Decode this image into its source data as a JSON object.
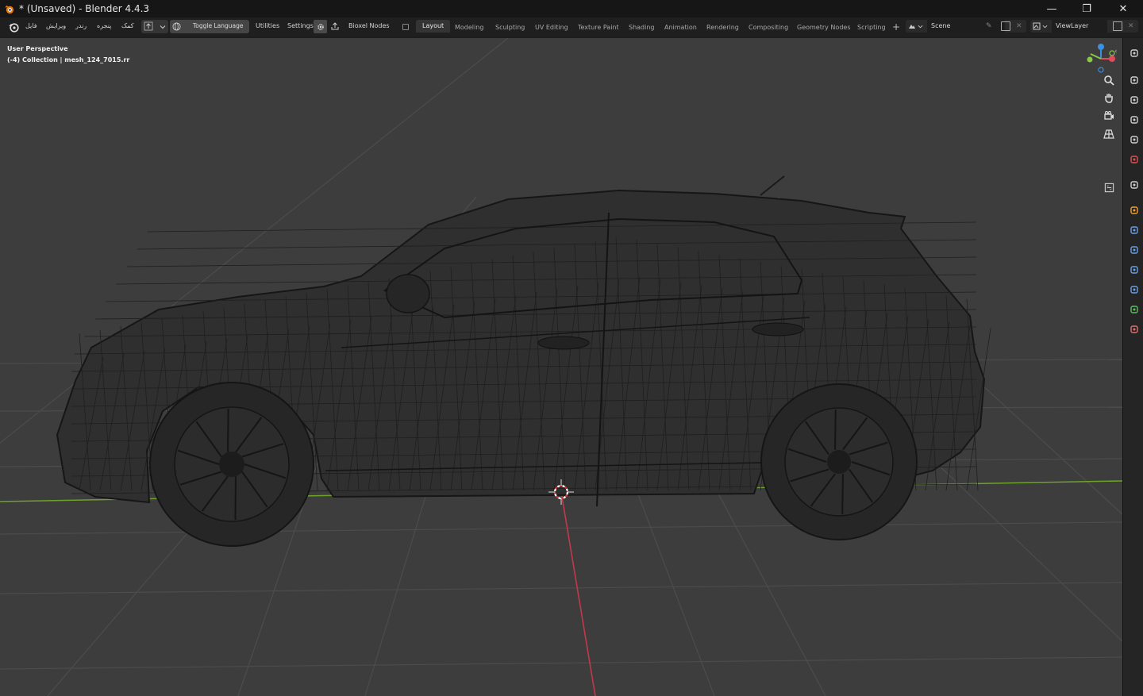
{
  "window": {
    "title": "* (Unsaved) - Blender 4.4.3",
    "minimize": "—",
    "maximize": "❐",
    "close": "✕"
  },
  "menu": {
    "items": [
      "فایل",
      "ویرایش",
      "رندر",
      "پنجره",
      "کمک"
    ],
    "toggle_language": "Toggle Language",
    "utilities": "Utilities",
    "settings": "Settings",
    "bioxel": "Bioxel Nodes"
  },
  "workspaces": [
    "Layout",
    "Modeling",
    "Sculpting",
    "UV Editing",
    "Texture Paint",
    "Shading",
    "Animation",
    "Rendering",
    "Compositing",
    "Geometry Nodes",
    "Scripting"
  ],
  "workspace_add": "+",
  "scene": {
    "name": "Scene"
  },
  "view_layer": {
    "name": "ViewLayer"
  },
  "viewport": {
    "view_name": "User Perspective",
    "collection_info": "(-4) Collection | mesh_124_7015.rr",
    "shading": "wireframe"
  },
  "gizmo": {
    "x_color": "#e34a5b",
    "y_color": "#8bc84a",
    "z_color": "#3d8fe0"
  },
  "colors": {
    "viewport_bg": "#3d3d3d",
    "grid": "#4c4c4c",
    "x_axis": "#c2394b",
    "y_axis": "#6ea12a",
    "wire": "#1a1a1a",
    "active_tab": "#343434"
  },
  "nav_icons": [
    "zoom-icon",
    "pan-hand-icon",
    "camera-view-icon",
    "ortho-grid-icon"
  ],
  "properties_icons": [
    "tool-icon",
    "render-icon",
    "output-icon",
    "view-layer-icon",
    "scene-icon",
    "world-icon",
    "collection-icon",
    "object-icon",
    "modifier-icon",
    "particles-icon",
    "physics-icon",
    "constraints-icon",
    "data-icon",
    "material-icon"
  ]
}
